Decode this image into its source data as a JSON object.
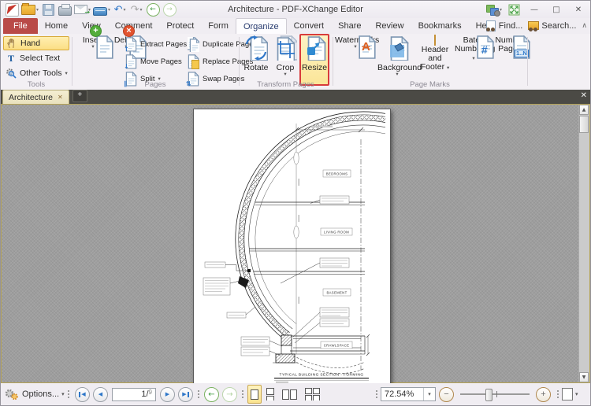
{
  "window": {
    "title": "Architecture - PDF-XChange Editor"
  },
  "menu": {
    "tabs": [
      "File",
      "Home",
      "View",
      "Comment",
      "Protect",
      "Form",
      "Organize",
      "Convert",
      "Share",
      "Review",
      "Bookmarks",
      "Help"
    ],
    "active_tab": "Organize",
    "find": "Find...",
    "search": "Search..."
  },
  "ribbon": {
    "tools": {
      "label": "Tools",
      "hand": "Hand",
      "select_text": "Select Text",
      "other_tools": "Other Tools"
    },
    "pages": {
      "label": "Pages",
      "insert": "Insert",
      "delete": "Delete",
      "col1": [
        "Extract Pages",
        "Move Pages",
        "Split"
      ],
      "col2": [
        "Duplicate Pages",
        "Replace Pages",
        "Swap Pages"
      ]
    },
    "transform": {
      "label": "Transform Pages",
      "rotate": "Rotate",
      "crop": "Crop",
      "resize": "Resize"
    },
    "page_marks": {
      "label": "Page Marks",
      "watermarks": "Watermarks",
      "background": "Background",
      "header_footer": "Header and Footer",
      "bates": "Bates Numbering",
      "number_pages": "Number Pages"
    }
  },
  "doc_tab": {
    "title": "Architecture"
  },
  "drawing": {
    "rooms": [
      "BEDROOMS",
      "LIVING ROOM",
      "BASEMENT",
      "CRAWLSPACE"
    ],
    "caption": "TYPICAL BUILDING SECTION - FORMING"
  },
  "status": {
    "options": "Options...",
    "page_current": "1",
    "page_sep": "/",
    "page_total": "9",
    "zoom": "72.54%"
  },
  "glyphs": {
    "caret": "▾",
    "chevron_collapse": "∧",
    "close": "✕",
    "tab_close": "✕",
    "new_tab": "+",
    "minimize": "—",
    "maximize": "□",
    "undo": "↶",
    "redo": "↷",
    "back": "←",
    "forward": "→",
    "mail_arrow": "→",
    "tri_left": "◀",
    "tri_right": "▶",
    "minus": "−",
    "plus": "+",
    "scroll_up": "▲",
    "scroll_down": "▼"
  },
  "icons": {
    "watermark_glyph": "A",
    "bates_glyph": "#",
    "number_pages_glyph": "1..N",
    "select_text_glyph": "T",
    "extract_glyph": "↑",
    "move_glyph": "↓",
    "split_glyph": "∥",
    "swap_glyph": "⇅"
  },
  "colors": {
    "annotation_red": "#d83b3b",
    "highlight_yellow": "#fbe598",
    "file_tab_red": "#b94a48",
    "icon_blue": "#2f77c9",
    "tab_cream": "#efe8c8",
    "canvas_gray": "#9e9e9e"
  }
}
